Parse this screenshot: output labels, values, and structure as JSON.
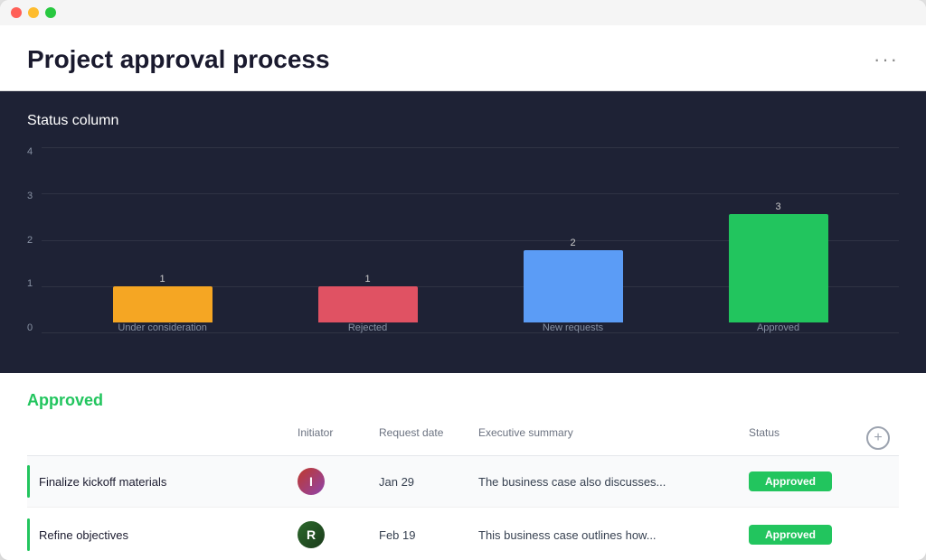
{
  "window": {
    "title": "Project approval process"
  },
  "header": {
    "title": "Project approval process",
    "more_icon": "···"
  },
  "chart": {
    "title": "Status column",
    "y_labels": [
      "0",
      "1",
      "2",
      "3",
      "4"
    ],
    "bars": [
      {
        "label": "Under consideration",
        "value": 1,
        "color": "#f5a623",
        "height_pct": 25
      },
      {
        "label": "Rejected",
        "value": 1,
        "color": "#e05263",
        "height_pct": 25
      },
      {
        "label": "New requests",
        "value": 2,
        "color": "#5b9cf6",
        "height_pct": 50
      },
      {
        "label": "Approved",
        "value": 3,
        "color": "#22c55e",
        "height_pct": 75
      }
    ],
    "max": 4
  },
  "table": {
    "heading": "Approved",
    "columns": [
      "",
      "Initiator",
      "Request date",
      "Executive summary",
      "Status",
      ""
    ],
    "rows": [
      {
        "title": "Finalize kickoff materials",
        "initiator_initial": "I",
        "request_date": "Jan 29",
        "summary": "The business case also discusses...",
        "status": "Approved"
      },
      {
        "title": "Refine objectives",
        "initiator_initial": "R",
        "request_date": "Feb 19",
        "summary": "This business case outlines how...",
        "status": "Approved"
      }
    ]
  },
  "icons": {
    "more": "•••",
    "add": "+"
  }
}
